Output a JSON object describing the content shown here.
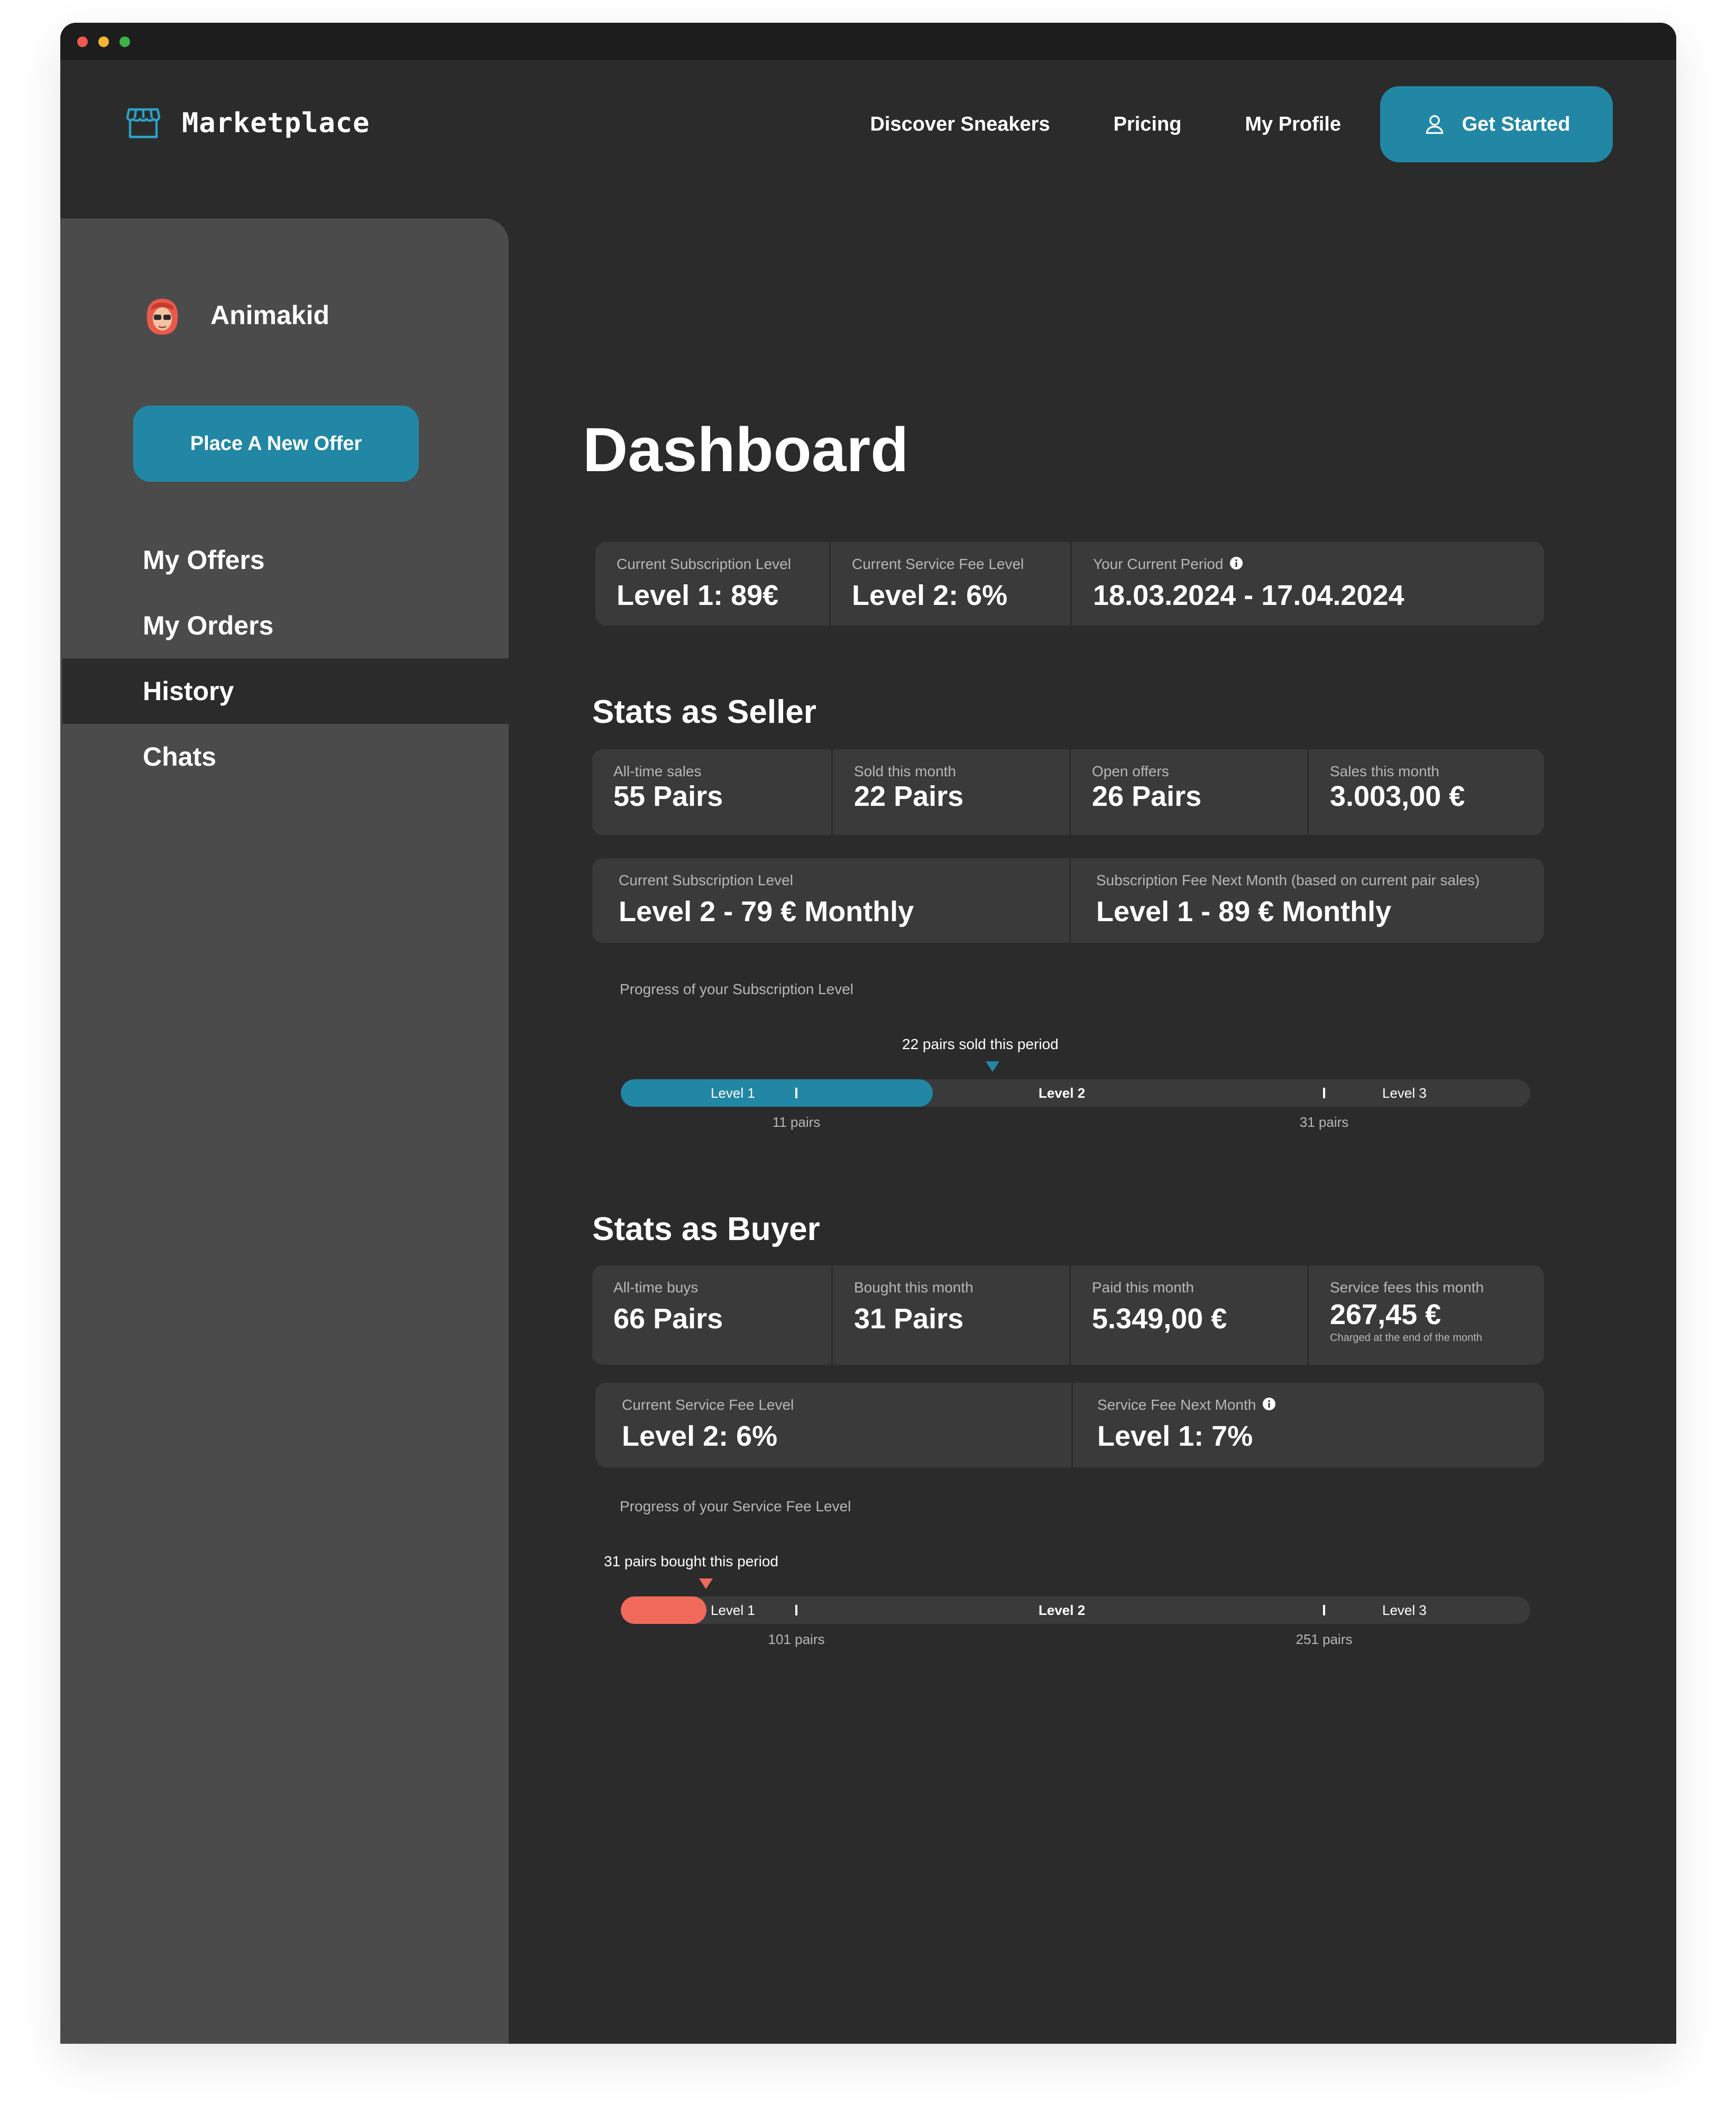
{
  "colors": {
    "accent": "#2187a4",
    "buyer_accent": "#f0695a",
    "background": "#2b2b2c",
    "sidebar": "#4b4b4c",
    "card": "#3a3a3b"
  },
  "header": {
    "logo_text": "Marketplace",
    "logo_icon": "storefront-icon",
    "nav": [
      "Discover Sneakers",
      "Pricing",
      "My Profile"
    ],
    "cta_label": "Get Started",
    "cta_icon": "user-icon"
  },
  "sidebar": {
    "username": "Animakid",
    "new_offer_label": "Place A New Offer",
    "menu": [
      "My Offers",
      "My Orders",
      "History",
      "Chats"
    ],
    "active_item": "History"
  },
  "main": {
    "title": "Dashboard",
    "overview": [
      {
        "label": "Current Subscription Level",
        "value": "Level 1: 89€"
      },
      {
        "label": "Current Service Fee Level",
        "value": "Level 2: 6%"
      },
      {
        "label": "Your Current Period",
        "value": "18.03.2024 - 17.04.2024",
        "icon": "info-icon"
      }
    ],
    "seller": {
      "title": "Stats as Seller",
      "stats": [
        {
          "label": "All-time sales",
          "value": "55 Pairs"
        },
        {
          "label": "Sold this month",
          "value": "22 Pairs"
        },
        {
          "label": "Open offers",
          "value": "26 Pairs"
        },
        {
          "label": "Sales this month",
          "value": "3.003,00 €"
        }
      ],
      "levels": [
        {
          "label": "Current Subscription Level",
          "value": "Level 2 - 79 € Monthly"
        },
        {
          "label": "Subscription Fee Next Month (based on current pair sales)",
          "value": "Level 1 - 89 € Monthly"
        }
      ],
      "progress": {
        "label": "Progress of your Subscription Level",
        "marker_text": "22 pairs sold this period",
        "current": 22,
        "fill_fraction": 0.343,
        "level_labels": [
          "Level 1",
          "Level 2",
          "Level 3"
        ],
        "thresholds": [
          "11 pairs",
          "31 pairs"
        ]
      }
    },
    "buyer": {
      "title": "Stats as Buyer",
      "stats": [
        {
          "label": "All-time buys",
          "value": "66 Pairs"
        },
        {
          "label": "Bought this month",
          "value": "31 Pairs"
        },
        {
          "label": "Paid this month",
          "value": "5.349,00 €"
        },
        {
          "label": "Service fees this month",
          "value": "267,45 €",
          "note": "Charged at the end of the month"
        }
      ],
      "levels": [
        {
          "label": "Current Service Fee Level",
          "value": "Level 2: 6%"
        },
        {
          "label": "Service Fee Next Month",
          "value": "Level 1: 7%",
          "icon": "info-icon"
        }
      ],
      "progress": {
        "label": "Progress of your Service Fee Level",
        "marker_text": "31 pairs bought this period",
        "current": 31,
        "fill_fraction": 0.094,
        "level_labels": [
          "Level 1",
          "Level 2",
          "Level 3"
        ],
        "thresholds": [
          "101 pairs",
          "251 pairs"
        ]
      }
    }
  }
}
